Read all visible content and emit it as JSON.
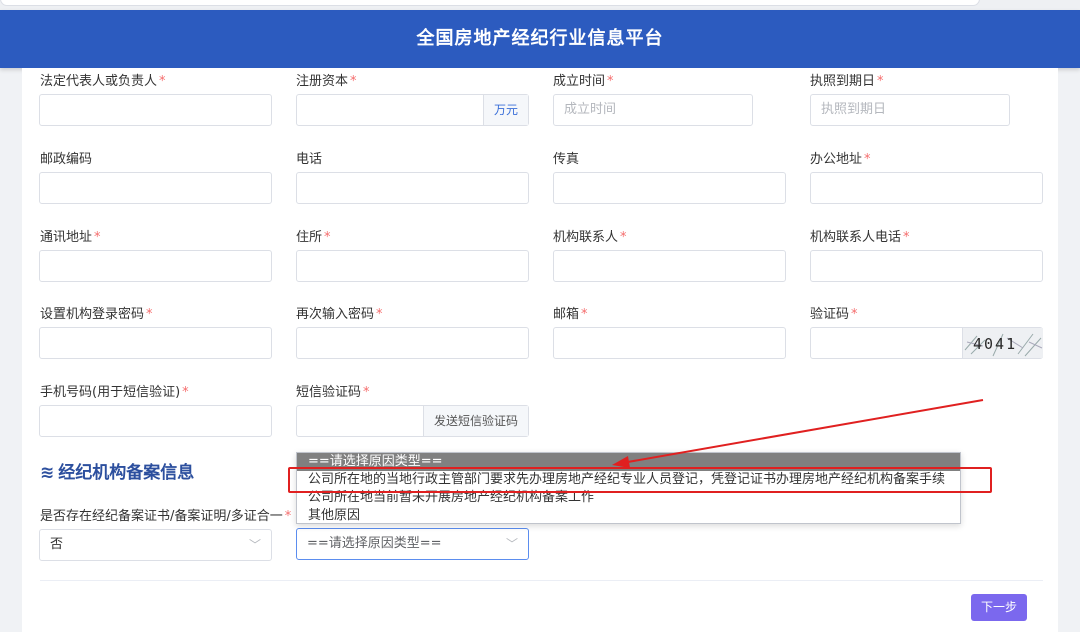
{
  "header": {
    "title": "全国房地产经纪行业信息平台"
  },
  "fields": {
    "legal_rep": {
      "label": "法定代表人或负责人",
      "required": "*",
      "value": ""
    },
    "capital": {
      "label": "注册资本",
      "required": "*",
      "value": "",
      "unit": "万元"
    },
    "established": {
      "label": "成立时间",
      "required": "*",
      "placeholder": "成立时间"
    },
    "license_expiry": {
      "label": "执照到期日",
      "required": "*",
      "placeholder": "执照到期日"
    },
    "postcode": {
      "label": "邮政编码",
      "required": "",
      "value": ""
    },
    "phone": {
      "label": "电话",
      "required": "",
      "value": ""
    },
    "fax": {
      "label": "传真",
      "required": "",
      "value": ""
    },
    "office_address": {
      "label": "办公地址",
      "required": "*",
      "value": ""
    },
    "mail_address": {
      "label": "通讯地址",
      "required": "*",
      "value": ""
    },
    "residence": {
      "label": "住所",
      "required": "*",
      "value": ""
    },
    "contact": {
      "label": "机构联系人",
      "required": "*",
      "value": ""
    },
    "contact_phone": {
      "label": "机构联系人电话",
      "required": "*",
      "value": ""
    },
    "password": {
      "label": "设置机构登录密码",
      "required": "*",
      "value": ""
    },
    "password_confirm": {
      "label": "再次输入密码",
      "required": "*",
      "value": ""
    },
    "email": {
      "label": "邮箱",
      "required": "*",
      "value": ""
    },
    "captcha": {
      "label": "验证码",
      "required": "*",
      "value": "",
      "image_text": "4041"
    },
    "mobile": {
      "label": "手机号码(用于短信验证)",
      "required": "*",
      "value": ""
    },
    "sms_code": {
      "label": "短信验证码",
      "required": "*",
      "value": "",
      "button": "发送短信验证码"
    }
  },
  "section": {
    "icon": "layers-icon",
    "title": "经纪机构备案信息"
  },
  "filing": {
    "has_cert": {
      "label": "是否存在经纪备案证书/备案证明/多证合一",
      "required": "*",
      "value": "否"
    },
    "reason": {
      "value": "==请选择原因类型=="
    }
  },
  "dropdown": {
    "options": [
      "==请选择原因类型==",
      "公司所在地的当地行政主管部门要求先办理房地产经纪专业人员登记，凭登记证书办理房地产经纪机构备案手续",
      "公司所在地当前暂未开展房地产经纪机构备案工作",
      "其他原因"
    ],
    "selected_index": 0,
    "highlighted_index": 1
  },
  "footer": {
    "next_label": "下一步"
  },
  "colors": {
    "header": "#2c5bbf",
    "required": "#f56c6c",
    "highlight_box": "#e02020",
    "next_button": "#7b68ee"
  }
}
